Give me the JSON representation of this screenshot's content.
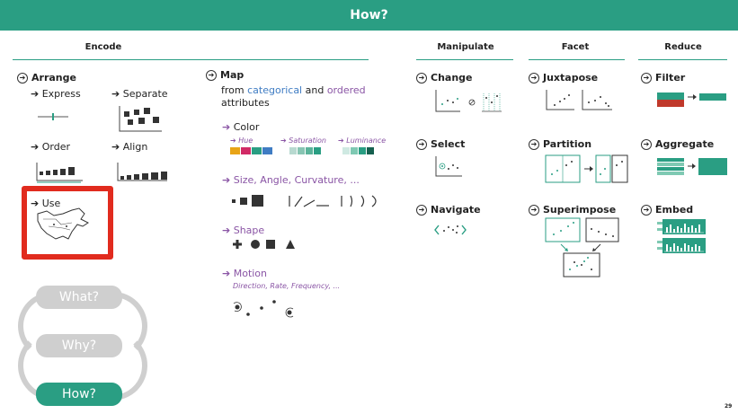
{
  "header": {
    "title": "How?"
  },
  "columns": {
    "encode": "Encode",
    "manipulate": "Manipulate",
    "facet": "Facet",
    "reduce": "Reduce"
  },
  "encode": {
    "arrange": {
      "title": "Arrange",
      "express": "Express",
      "separate": "Separate",
      "order": "Order",
      "align": "Align",
      "use": "Use"
    },
    "map": {
      "title": "Map",
      "line1_prefix": "from ",
      "categorical": "categorical",
      "and": " and ",
      "ordered": "ordered",
      "line2": "attributes",
      "color": "Color",
      "hue": "Hue",
      "saturation": "Saturation",
      "luminance": "Luminance",
      "size": "Size, Angle, Curvature, ...",
      "shape": "Shape",
      "motion": "Motion",
      "motion_sub": "Direction, Rate, Frequency, ..."
    }
  },
  "manipulate": {
    "change": "Change",
    "select": "Select",
    "navigate": "Navigate"
  },
  "facet": {
    "juxtapose": "Juxtapose",
    "partition": "Partition",
    "superimpose": "Superimpose"
  },
  "reduce": {
    "filter": "Filter",
    "aggregate": "Aggregate",
    "embed": "Embed"
  },
  "nav": {
    "what": "What?",
    "why": "Why?",
    "how": "How?"
  },
  "page_number": "29",
  "colors": {
    "teal": "#2a9e83",
    "red": "#e12b1e",
    "purple": "#8a55a5",
    "blue": "#3f7cc3",
    "grey": "#cfcfcf"
  }
}
